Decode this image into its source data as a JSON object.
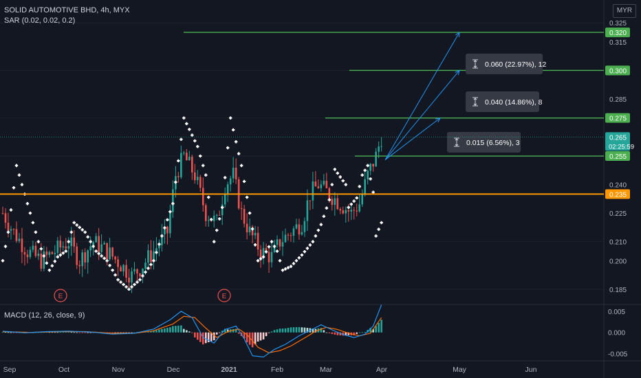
{
  "header": {
    "title": "SOLID AUTOMOTIVE BHD, 4h, MYX",
    "sar_label": "SAR (0.02, 0.02, 0.2)",
    "currency": "MYR",
    "macd_label": "MACD (12, 26, close, 9)"
  },
  "colors": {
    "background": "#131722",
    "up": "#26a69a",
    "down": "#ef5350",
    "sar": "#ffffff",
    "support": "#ff9800",
    "target": "#4caf50",
    "arrow": "#2196f3",
    "macd": "#2196f3",
    "signal": "#ff6d00",
    "grid": "#1e222d"
  },
  "chart_data": {
    "type": "candlestick",
    "price_axis": {
      "ticks": [
        "0.325",
        "0.315",
        "0.300",
        "0.285",
        "0.275",
        "0.265",
        "0.255",
        "0.240",
        "0.235",
        "0.225",
        "0.210",
        "0.200",
        "0.185"
      ],
      "range": [
        0.177,
        0.337
      ]
    },
    "time_axis": {
      "labels": [
        "Sep",
        "Oct",
        "Nov",
        "Dec",
        "2021",
        "Feb",
        "Mar",
        "Apr",
        "May",
        "Jun"
      ]
    },
    "last_price": {
      "value": "0.265",
      "countdown": "02:25:59"
    },
    "support_line": {
      "value": 0.235,
      "label": "0.235"
    },
    "target_lines": [
      {
        "value": 0.32,
        "label": "0.320"
      },
      {
        "value": 0.3,
        "label": "0.300"
      },
      {
        "value": 0.275,
        "label": "0.275"
      },
      {
        "value": 0.255,
        "label": "0.255"
      }
    ],
    "measurements": [
      {
        "text": "0.060 (22.97%), 12"
      },
      {
        "text": "0.040 (14.86%), 8"
      },
      {
        "text": "0.015 (6.56%), 3"
      }
    ],
    "earnings_markers": [
      "E",
      "E"
    ],
    "price_anchors": [
      [
        0,
        0.225
      ],
      [
        4,
        0.215
      ],
      [
        9,
        0.205
      ],
      [
        14,
        0.2
      ],
      [
        19,
        0.205
      ],
      [
        24,
        0.21
      ],
      [
        28,
        0.2
      ],
      [
        33,
        0.21
      ],
      [
        38,
        0.205
      ],
      [
        43,
        0.198
      ],
      [
        47,
        0.192
      ],
      [
        50,
        0.196
      ],
      [
        55,
        0.205
      ],
      [
        60,
        0.215
      ],
      [
        63,
        0.245
      ],
      [
        66,
        0.255
      ],
      [
        70,
        0.245
      ],
      [
        74,
        0.225
      ],
      [
        78,
        0.22
      ],
      [
        81,
        0.24
      ],
      [
        84,
        0.245
      ],
      [
        87,
        0.225
      ],
      [
        90,
        0.215
      ],
      [
        94,
        0.205
      ],
      [
        98,
        0.202
      ],
      [
        101,
        0.21
      ],
      [
        105,
        0.215
      ],
      [
        109,
        0.22
      ],
      [
        112,
        0.235
      ],
      [
        115,
        0.24
      ],
      [
        119,
        0.235
      ],
      [
        123,
        0.23
      ],
      [
        127,
        0.225
      ],
      [
        130,
        0.23
      ],
      [
        133,
        0.245
      ],
      [
        136,
        0.255
      ],
      [
        138,
        0.265
      ]
    ],
    "sar_anchors": [
      [
        0,
        0.2
      ],
      [
        2,
        0.215
      ],
      [
        5,
        0.25
      ],
      [
        9,
        0.23
      ],
      [
        13,
        0.21
      ],
      [
        17,
        0.195
      ],
      [
        20,
        0.202
      ],
      [
        23,
        0.205
      ],
      [
        26,
        0.22
      ],
      [
        30,
        0.215
      ],
      [
        34,
        0.205
      ],
      [
        38,
        0.2
      ],
      [
        42,
        0.19
      ],
      [
        46,
        0.185
      ],
      [
        50,
        0.19
      ],
      [
        55,
        0.2
      ],
      [
        58,
        0.213
      ],
      [
        62,
        0.23
      ],
      [
        66,
        0.275
      ],
      [
        71,
        0.26
      ],
      [
        74,
        0.245
      ],
      [
        77,
        0.21
      ],
      [
        80,
        0.228
      ],
      [
        83,
        0.275
      ],
      [
        87,
        0.25
      ],
      [
        90,
        0.225
      ],
      [
        93,
        0.2
      ],
      [
        95,
        0.202
      ],
      [
        98,
        0.21
      ],
      [
        100,
        0.205
      ],
      [
        102,
        0.195
      ],
      [
        105,
        0.197
      ],
      [
        109,
        0.203
      ],
      [
        113,
        0.21
      ],
      [
        116,
        0.219
      ],
      [
        119,
        0.232
      ],
      [
        121,
        0.248
      ],
      [
        125,
        0.24
      ],
      [
        126,
        0.228
      ],
      [
        129,
        0.233
      ],
      [
        131,
        0.245
      ],
      [
        133,
        0.25
      ],
      [
        135,
        0.236
      ],
      [
        136,
        0.213
      ],
      [
        138,
        0.22
      ]
    ],
    "macd": {
      "ticks": [
        "0.005",
        "0.000",
        "-0.005"
      ],
      "range": [
        -0.0067,
        0.0066
      ],
      "macd_anchors": [
        [
          0,
          0.0003
        ],
        [
          8,
          -0.0001
        ],
        [
          16,
          0.0002
        ],
        [
          24,
          0.0003
        ],
        [
          32,
          0.0001
        ],
        [
          40,
          -0.0004
        ],
        [
          48,
          -0.0002
        ],
        [
          55,
          0.0008
        ],
        [
          61,
          0.003
        ],
        [
          65,
          0.005
        ],
        [
          69,
          0.0035
        ],
        [
          73,
          -0.0012
        ],
        [
          77,
          -0.0025
        ],
        [
          81,
          0.0007
        ],
        [
          85,
          0.0015
        ],
        [
          88,
          -0.0015
        ],
        [
          91,
          -0.0055
        ],
        [
          95,
          -0.0058
        ],
        [
          99,
          -0.004
        ],
        [
          103,
          -0.0028
        ],
        [
          108,
          -0.0008
        ],
        [
          112,
          0.0005
        ],
        [
          116,
          0.0018
        ],
        [
          120,
          0.0006
        ],
        [
          124,
          -0.0005
        ],
        [
          128,
          -0.0012
        ],
        [
          132,
          -0.0004
        ],
        [
          135,
          0.0015
        ],
        [
          138,
          0.0065
        ]
      ],
      "signal_anchors": [
        [
          0,
          0.0002
        ],
        [
          10,
          0.0
        ],
        [
          20,
          0.0002
        ],
        [
          30,
          0.0002
        ],
        [
          40,
          -0.0002
        ],
        [
          48,
          -0.0002
        ],
        [
          55,
          0.0004
        ],
        [
          62,
          0.002
        ],
        [
          66,
          0.0038
        ],
        [
          70,
          0.0035
        ],
        [
          74,
          0.001
        ],
        [
          78,
          -0.0012
        ],
        [
          82,
          0.0002
        ],
        [
          86,
          0.0008
        ],
        [
          89,
          -0.0005
        ],
        [
          93,
          -0.0035
        ],
        [
          97,
          -0.0048
        ],
        [
          101,
          -0.0043
        ],
        [
          105,
          -0.0032
        ],
        [
          110,
          -0.0013
        ],
        [
          114,
          0.0003
        ],
        [
          118,
          0.0012
        ],
        [
          122,
          0.0007
        ],
        [
          126,
          -0.0002
        ],
        [
          130,
          -0.0008
        ],
        [
          134,
          -0.0002
        ],
        [
          138,
          0.0035
        ]
      ]
    }
  }
}
